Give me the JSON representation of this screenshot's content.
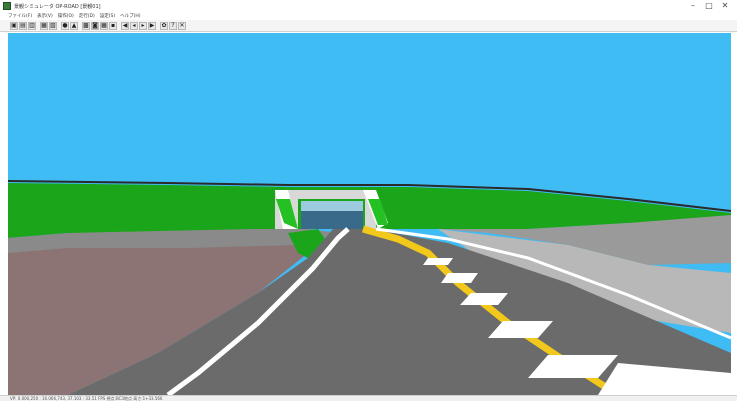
{
  "window": {
    "title": "景観シミュレータ OP-ROAD [景観01]",
    "minimize_glyph": "–",
    "maximize_glyph": "□",
    "close_glyph": "✕"
  },
  "menu": [
    {
      "label": "ファイル(F)"
    },
    {
      "label": "表示(V)"
    },
    {
      "label": "操作(O)"
    },
    {
      "label": "走行(D)"
    },
    {
      "label": "設定(S)"
    },
    {
      "label": "ヘルプ(H)"
    }
  ],
  "toolbar": {
    "buttons": [
      {
        "icon": "open-folder-icon",
        "glyph": "▣"
      },
      {
        "icon": "save-icon",
        "glyph": "▤"
      },
      {
        "icon": "save-as-icon",
        "glyph": "▥"
      },
      {
        "icon": "print-icon",
        "glyph": "▦"
      },
      {
        "icon": "preview-icon",
        "glyph": "▧"
      },
      {
        "icon": "globe-icon",
        "glyph": "●"
      },
      {
        "icon": "export-icon",
        "glyph": "▲"
      },
      {
        "icon": "view-icon",
        "glyph": "▩"
      },
      {
        "icon": "camera-icon",
        "glyph": "◙"
      },
      {
        "icon": "table-icon",
        "glyph": "▦"
      },
      {
        "icon": "grid-icon",
        "glyph": "▪"
      },
      {
        "icon": "first-frame-icon",
        "glyph": "◀"
      },
      {
        "icon": "prev-frame-icon",
        "glyph": "◂"
      },
      {
        "icon": "next-frame-icon",
        "glyph": "▸"
      },
      {
        "icon": "last-frame-icon",
        "glyph": "▶"
      },
      {
        "icon": "settings-icon",
        "glyph": "✿"
      },
      {
        "icon": "help-icon",
        "glyph": "?"
      },
      {
        "icon": "close-view-icon",
        "glyph": "✕"
      }
    ]
  },
  "status": {
    "text": "VP: 0.000,250 : 16.066,743, 37.103 : 33.51 FPS 視点:BC3地点 高さ:1+33.566"
  },
  "colors": {
    "sky": "#3fbcf3",
    "grass": "#1aa51a",
    "road": "#6b6b6b",
    "centerline": "#f2c81a",
    "edgeline": "#ffffff"
  }
}
